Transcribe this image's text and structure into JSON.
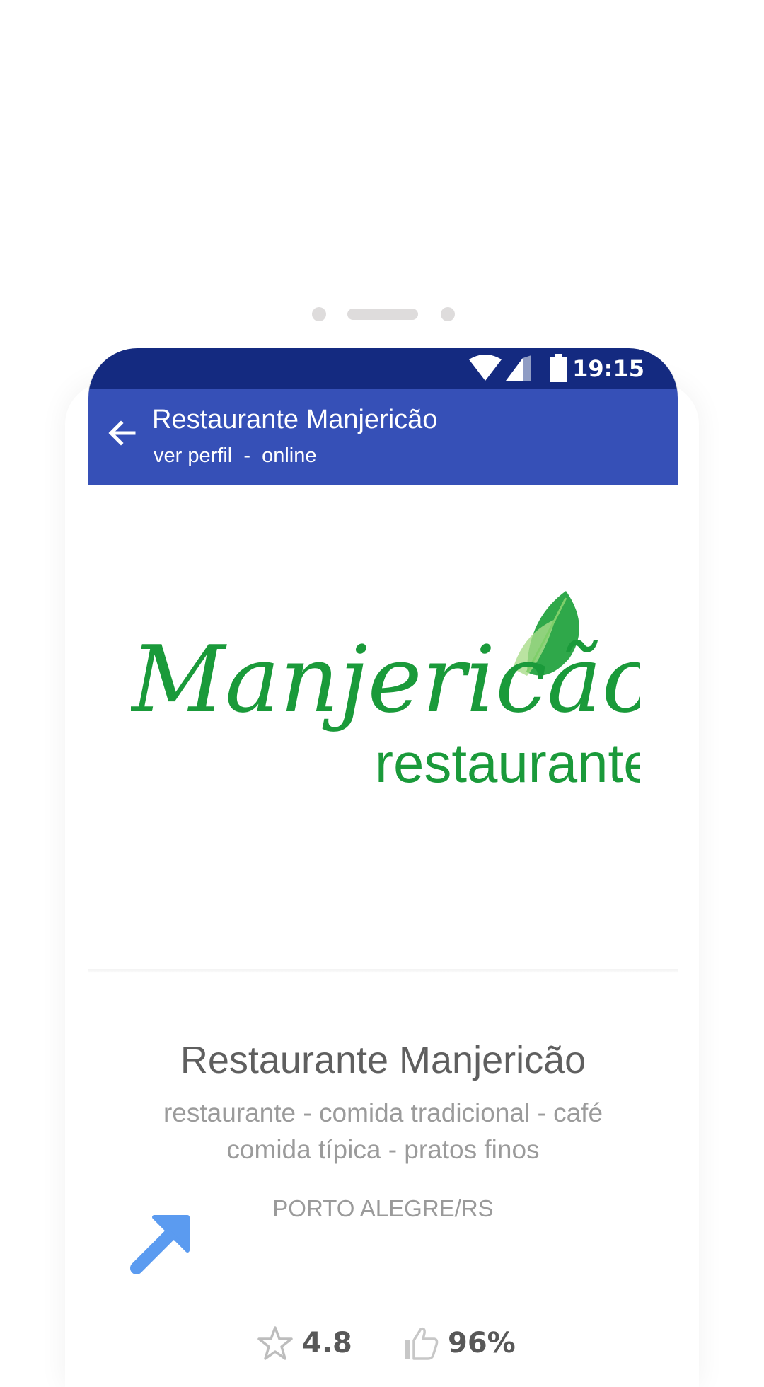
{
  "status_bar": {
    "time": "19:15"
  },
  "app_bar": {
    "title": "Restaurante Manjericão",
    "subtitle": "ver perfil  -  online"
  },
  "logo": {
    "wordmark": "Manjericão",
    "tagline": "restaurante"
  },
  "profile": {
    "name": "Restaurante Manjericão",
    "categories_line1": "restaurante - comida tradicional - café",
    "categories_line2": "comida típica - pratos finos",
    "location": "PORTO ALEGRE/RS",
    "rating": "4.8",
    "approval": "96%"
  },
  "colors": {
    "status_bar": "#142a80",
    "app_bar": "#3650b7",
    "logo_green": "#1a9a3a",
    "arrow_blue": "#5b9bf0"
  }
}
